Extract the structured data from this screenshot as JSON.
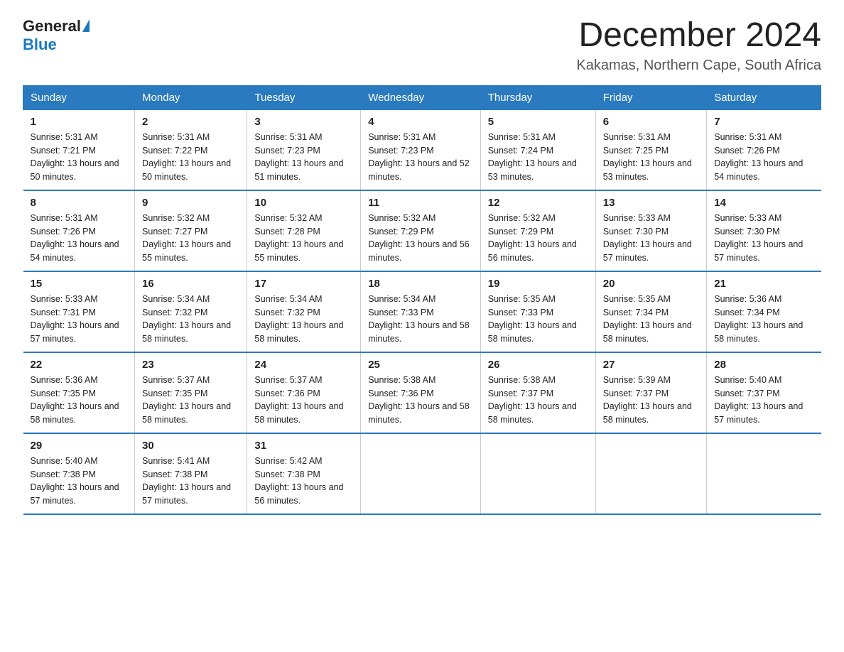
{
  "header": {
    "logo_general": "General",
    "logo_blue": "Blue",
    "month_title": "December 2024",
    "location": "Kakamas, Northern Cape, South Africa"
  },
  "weekdays": [
    "Sunday",
    "Monday",
    "Tuesday",
    "Wednesday",
    "Thursday",
    "Friday",
    "Saturday"
  ],
  "weeks": [
    [
      {
        "day": "1",
        "sunrise": "Sunrise: 5:31 AM",
        "sunset": "Sunset: 7:21 PM",
        "daylight": "Daylight: 13 hours and 50 minutes."
      },
      {
        "day": "2",
        "sunrise": "Sunrise: 5:31 AM",
        "sunset": "Sunset: 7:22 PM",
        "daylight": "Daylight: 13 hours and 50 minutes."
      },
      {
        "day": "3",
        "sunrise": "Sunrise: 5:31 AM",
        "sunset": "Sunset: 7:23 PM",
        "daylight": "Daylight: 13 hours and 51 minutes."
      },
      {
        "day": "4",
        "sunrise": "Sunrise: 5:31 AM",
        "sunset": "Sunset: 7:23 PM",
        "daylight": "Daylight: 13 hours and 52 minutes."
      },
      {
        "day": "5",
        "sunrise": "Sunrise: 5:31 AM",
        "sunset": "Sunset: 7:24 PM",
        "daylight": "Daylight: 13 hours and 53 minutes."
      },
      {
        "day": "6",
        "sunrise": "Sunrise: 5:31 AM",
        "sunset": "Sunset: 7:25 PM",
        "daylight": "Daylight: 13 hours and 53 minutes."
      },
      {
        "day": "7",
        "sunrise": "Sunrise: 5:31 AM",
        "sunset": "Sunset: 7:26 PM",
        "daylight": "Daylight: 13 hours and 54 minutes."
      }
    ],
    [
      {
        "day": "8",
        "sunrise": "Sunrise: 5:31 AM",
        "sunset": "Sunset: 7:26 PM",
        "daylight": "Daylight: 13 hours and 54 minutes."
      },
      {
        "day": "9",
        "sunrise": "Sunrise: 5:32 AM",
        "sunset": "Sunset: 7:27 PM",
        "daylight": "Daylight: 13 hours and 55 minutes."
      },
      {
        "day": "10",
        "sunrise": "Sunrise: 5:32 AM",
        "sunset": "Sunset: 7:28 PM",
        "daylight": "Daylight: 13 hours and 55 minutes."
      },
      {
        "day": "11",
        "sunrise": "Sunrise: 5:32 AM",
        "sunset": "Sunset: 7:29 PM",
        "daylight": "Daylight: 13 hours and 56 minutes."
      },
      {
        "day": "12",
        "sunrise": "Sunrise: 5:32 AM",
        "sunset": "Sunset: 7:29 PM",
        "daylight": "Daylight: 13 hours and 56 minutes."
      },
      {
        "day": "13",
        "sunrise": "Sunrise: 5:33 AM",
        "sunset": "Sunset: 7:30 PM",
        "daylight": "Daylight: 13 hours and 57 minutes."
      },
      {
        "day": "14",
        "sunrise": "Sunrise: 5:33 AM",
        "sunset": "Sunset: 7:30 PM",
        "daylight": "Daylight: 13 hours and 57 minutes."
      }
    ],
    [
      {
        "day": "15",
        "sunrise": "Sunrise: 5:33 AM",
        "sunset": "Sunset: 7:31 PM",
        "daylight": "Daylight: 13 hours and 57 minutes."
      },
      {
        "day": "16",
        "sunrise": "Sunrise: 5:34 AM",
        "sunset": "Sunset: 7:32 PM",
        "daylight": "Daylight: 13 hours and 58 minutes."
      },
      {
        "day": "17",
        "sunrise": "Sunrise: 5:34 AM",
        "sunset": "Sunset: 7:32 PM",
        "daylight": "Daylight: 13 hours and 58 minutes."
      },
      {
        "day": "18",
        "sunrise": "Sunrise: 5:34 AM",
        "sunset": "Sunset: 7:33 PM",
        "daylight": "Daylight: 13 hours and 58 minutes."
      },
      {
        "day": "19",
        "sunrise": "Sunrise: 5:35 AM",
        "sunset": "Sunset: 7:33 PM",
        "daylight": "Daylight: 13 hours and 58 minutes."
      },
      {
        "day": "20",
        "sunrise": "Sunrise: 5:35 AM",
        "sunset": "Sunset: 7:34 PM",
        "daylight": "Daylight: 13 hours and 58 minutes."
      },
      {
        "day": "21",
        "sunrise": "Sunrise: 5:36 AM",
        "sunset": "Sunset: 7:34 PM",
        "daylight": "Daylight: 13 hours and 58 minutes."
      }
    ],
    [
      {
        "day": "22",
        "sunrise": "Sunrise: 5:36 AM",
        "sunset": "Sunset: 7:35 PM",
        "daylight": "Daylight: 13 hours and 58 minutes."
      },
      {
        "day": "23",
        "sunrise": "Sunrise: 5:37 AM",
        "sunset": "Sunset: 7:35 PM",
        "daylight": "Daylight: 13 hours and 58 minutes."
      },
      {
        "day": "24",
        "sunrise": "Sunrise: 5:37 AM",
        "sunset": "Sunset: 7:36 PM",
        "daylight": "Daylight: 13 hours and 58 minutes."
      },
      {
        "day": "25",
        "sunrise": "Sunrise: 5:38 AM",
        "sunset": "Sunset: 7:36 PM",
        "daylight": "Daylight: 13 hours and 58 minutes."
      },
      {
        "day": "26",
        "sunrise": "Sunrise: 5:38 AM",
        "sunset": "Sunset: 7:37 PM",
        "daylight": "Daylight: 13 hours and 58 minutes."
      },
      {
        "day": "27",
        "sunrise": "Sunrise: 5:39 AM",
        "sunset": "Sunset: 7:37 PM",
        "daylight": "Daylight: 13 hours and 58 minutes."
      },
      {
        "day": "28",
        "sunrise": "Sunrise: 5:40 AM",
        "sunset": "Sunset: 7:37 PM",
        "daylight": "Daylight: 13 hours and 57 minutes."
      }
    ],
    [
      {
        "day": "29",
        "sunrise": "Sunrise: 5:40 AM",
        "sunset": "Sunset: 7:38 PM",
        "daylight": "Daylight: 13 hours and 57 minutes."
      },
      {
        "day": "30",
        "sunrise": "Sunrise: 5:41 AM",
        "sunset": "Sunset: 7:38 PM",
        "daylight": "Daylight: 13 hours and 57 minutes."
      },
      {
        "day": "31",
        "sunrise": "Sunrise: 5:42 AM",
        "sunset": "Sunset: 7:38 PM",
        "daylight": "Daylight: 13 hours and 56 minutes."
      },
      null,
      null,
      null,
      null
    ]
  ]
}
